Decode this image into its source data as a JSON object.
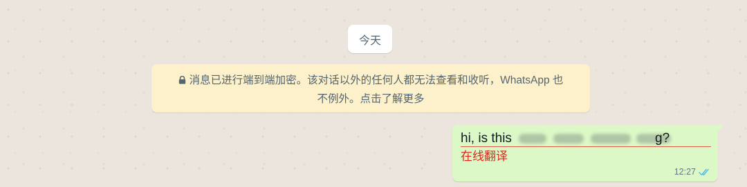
{
  "chat": {
    "date_label": "今天",
    "encryption_notice": {
      "line1": "消息已进行端到端加密。该对话以外的任何人都无法查看和收听，WhatsApp 也",
      "line2": "不例外。点击了解更多",
      "icon": "lock-icon"
    },
    "message": {
      "text_visible_prefix": "hi, is this",
      "text_visible_suffix": "g?",
      "translate_label": "在线翻译",
      "time": "12:27",
      "status_icon": "double-check-icon",
      "status_color": "#53bdeb"
    }
  },
  "colors": {
    "chat_background": "#ece5dd",
    "notice_background": "#fdf1cb",
    "outgoing_bubble": "#dcf8c6",
    "translate_red": "#e0241b"
  }
}
